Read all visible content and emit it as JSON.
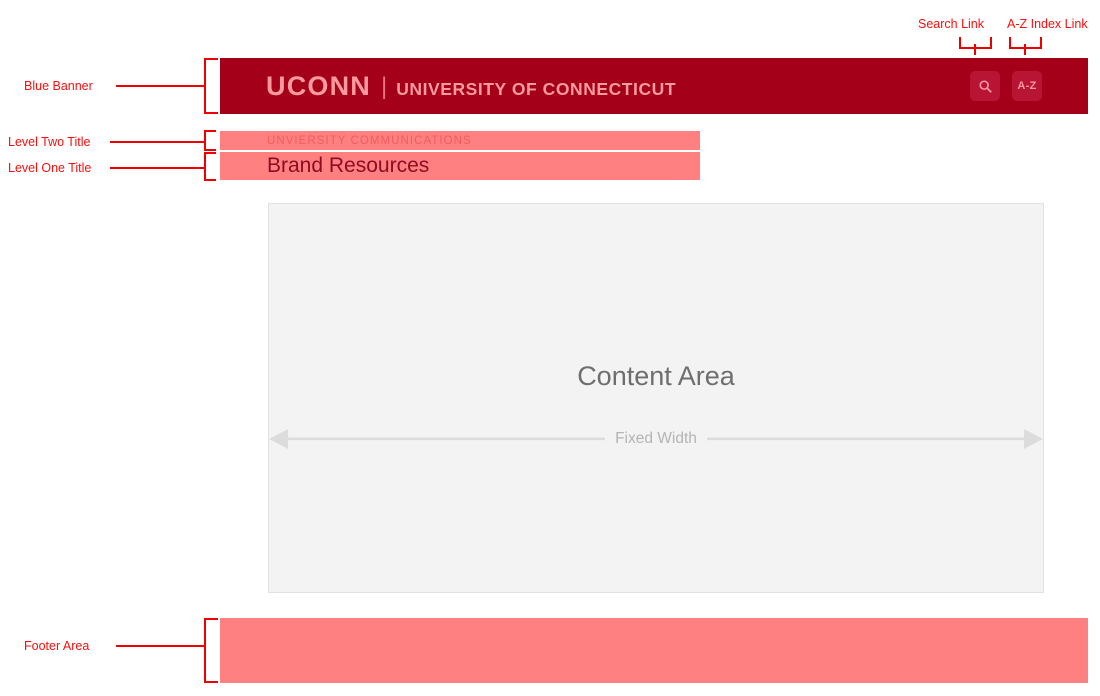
{
  "page": {
    "title": "UConn Website Template Wireframe Diagram",
    "annotation_color": "#ee0000",
    "banner_color": "#a4001a",
    "title_bar_color": "#ff8080",
    "footer_color": "#ff8080",
    "content_area_color": "#f3f3f3"
  },
  "banner": {
    "wordmark": "UCONN",
    "divider": "|",
    "subtitle": "UNIVERSITY OF CONNECTICUT",
    "search_button": {
      "icon": "search-icon",
      "label": ""
    },
    "az_button": {
      "icon": "az-index-icon",
      "label": "A-Z"
    }
  },
  "titles": {
    "level_two": "UNVIERSITY COMMUNICATIONS",
    "level_one": "Brand Resources"
  },
  "content": {
    "title": "Content Area",
    "width_label": "Fixed Width"
  },
  "annotations": {
    "search_link": "Search Link",
    "az_index_link": "A-Z Index Link",
    "blue_banner": "Blue Banner",
    "level_two_title": "Level Two Title",
    "level_one_title": "Level One Title",
    "footer_area": "Footer Area"
  }
}
